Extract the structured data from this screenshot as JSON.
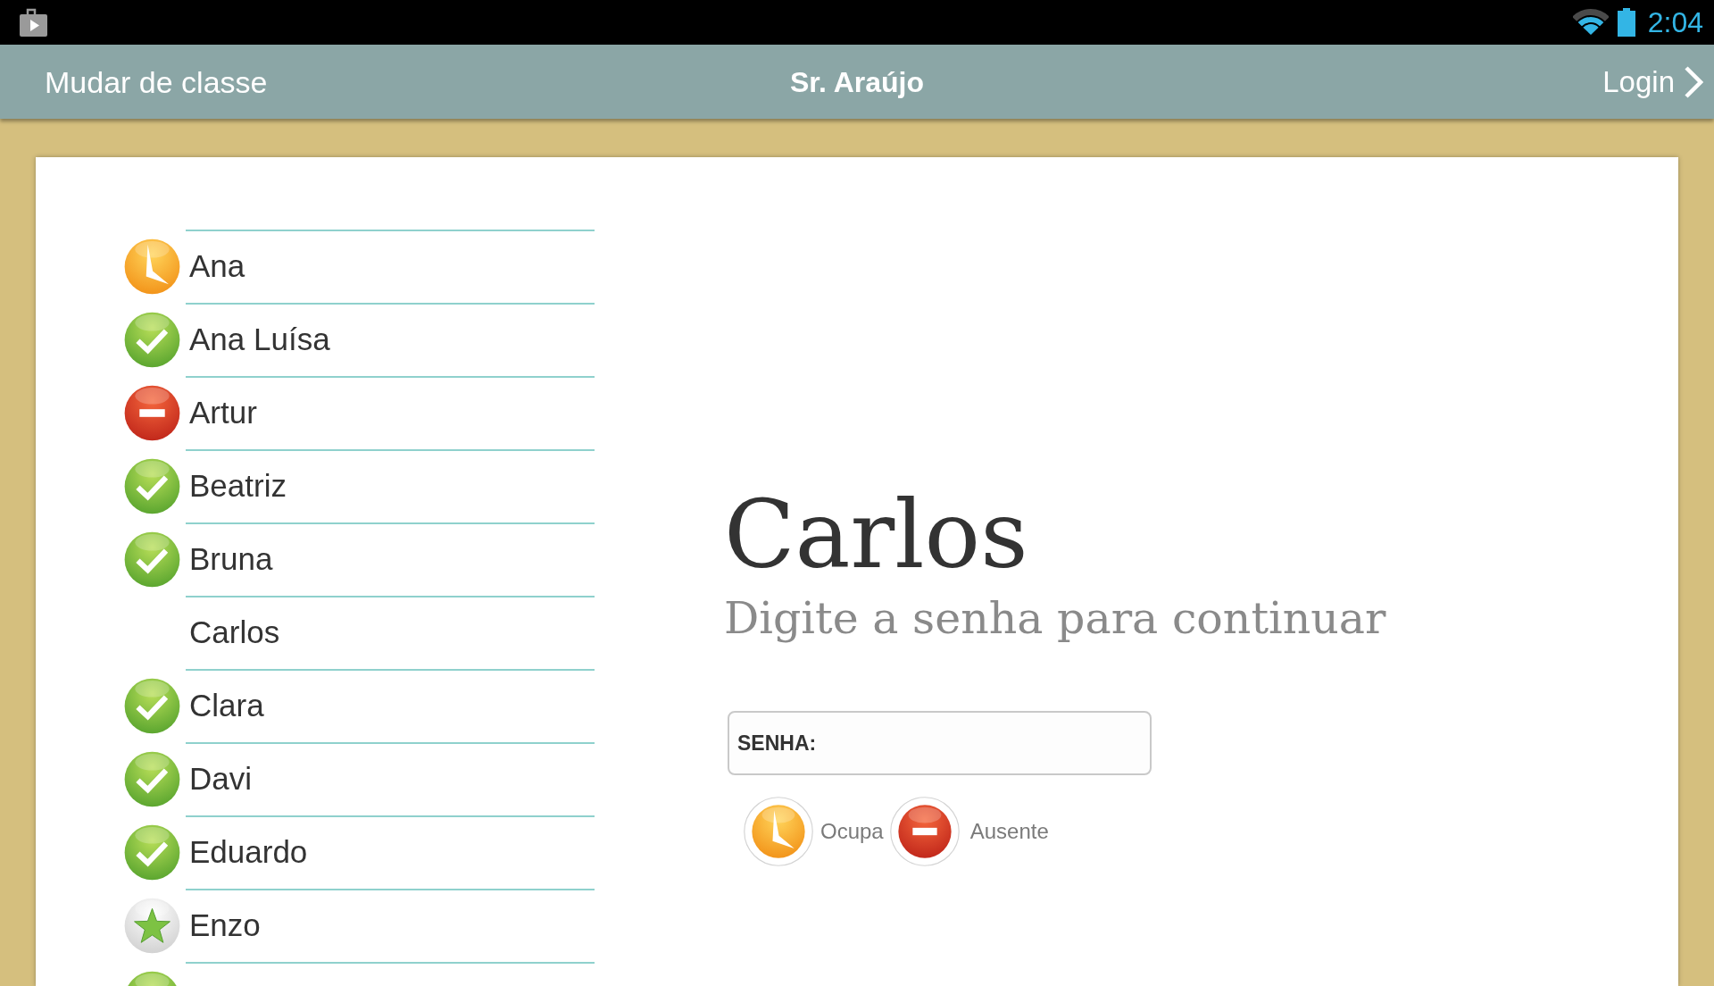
{
  "status_bar": {
    "time": "2:04"
  },
  "header": {
    "left_action": "Mudar de classe",
    "title": "Sr. Araújo",
    "right_action": "Login"
  },
  "students": [
    {
      "name": "Ana",
      "kind": "busy"
    },
    {
      "name": "Ana Luísa",
      "kind": "present"
    },
    {
      "name": "Artur",
      "kind": "absent"
    },
    {
      "name": "Beatriz",
      "kind": "present"
    },
    {
      "name": "Bruna",
      "kind": "present"
    },
    {
      "name": "Carlos",
      "kind": "plain"
    },
    {
      "name": "Clara",
      "kind": "present"
    },
    {
      "name": "Davi",
      "kind": "present"
    },
    {
      "name": "Eduardo",
      "kind": "present"
    },
    {
      "name": "Enzo",
      "kind": "star"
    },
    {
      "kind": "present"
    }
  ],
  "login": {
    "name": "Carlos",
    "prompt": "Digite a senha para continuar",
    "password": {
      "label": "SENHA:"
    }
  },
  "status_buttons": [
    {
      "kind": "busy",
      "label": "Ocupa"
    },
    {
      "kind": "absent",
      "label": "Ausente"
    }
  ]
}
